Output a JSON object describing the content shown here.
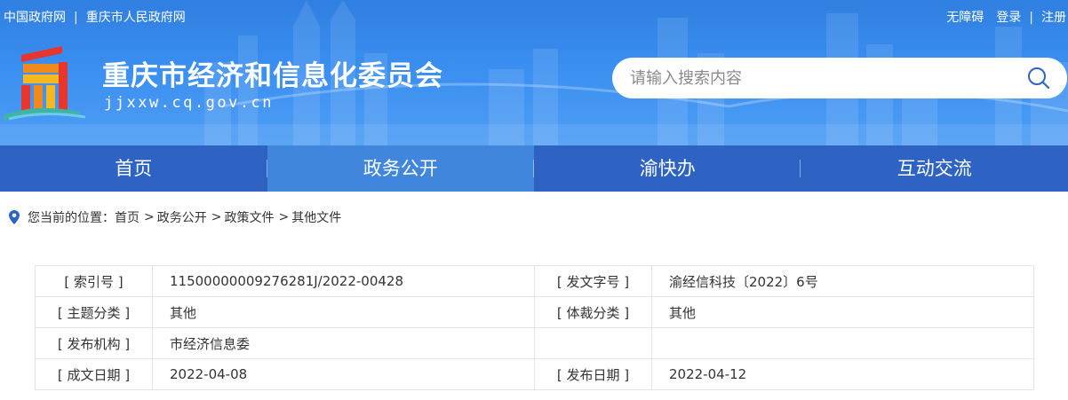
{
  "top_links": {
    "left": [
      "中国政府网",
      "重庆市人民政府网"
    ],
    "right": {
      "accessibility": "无障碍",
      "login": "登录",
      "register": "注册"
    }
  },
  "site": {
    "title": "重庆市经济和信息化委员会",
    "domain": "jjxxw.cq.gov.cn"
  },
  "search": {
    "placeholder": "请输入搜索内容"
  },
  "nav": [
    {
      "label": "首页",
      "active": false
    },
    {
      "label": "政务公开",
      "active": true
    },
    {
      "label": "渝快办",
      "active": false
    },
    {
      "label": "互动交流",
      "active": false
    }
  ],
  "breadcrumb": {
    "prefix": "您当前的位置：",
    "items": [
      "首页",
      "政务公开",
      "政策文件",
      "其他文件"
    ],
    "sep": ">"
  },
  "info": {
    "rows": [
      {
        "l1": "[ 索引号 ]",
        "v1": "11500000009276281J/2022-00428",
        "l2": "[ 发文字号 ]",
        "v2": "渝经信科技〔2022〕6号"
      },
      {
        "l1": "[ 主题分类 ]",
        "v1": "其他",
        "l2": "[ 体裁分类 ]",
        "v2": "其他"
      },
      {
        "l1": "[ 发布机构 ]",
        "v1": "市经济信息委",
        "l2": "",
        "v2": ""
      },
      {
        "l1": "[ 成文日期 ]",
        "v1": "2022-04-08",
        "l2": "[ 发布日期 ]",
        "v2": "2022-04-12"
      }
    ]
  },
  "colors": {
    "nav_bg": "#2e63c4",
    "nav_active": "#3f86dc",
    "header_bg": "#3a8ef0"
  }
}
